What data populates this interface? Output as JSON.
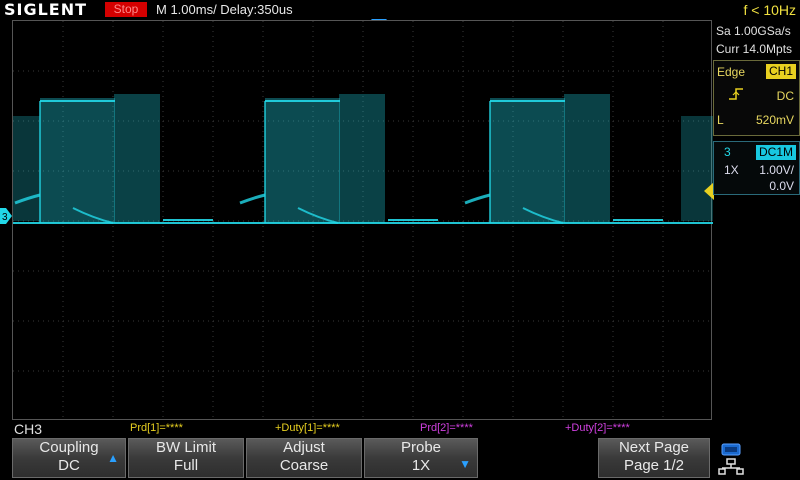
{
  "topbar": {
    "brand": "SIGLENT",
    "run_state": "Stop",
    "timebase": "M 1.00ms/ Delay:350us",
    "frequency": "f < 10Hz"
  },
  "acquisition": {
    "sample_rate": "Sa 1.00GSa/s",
    "memory_depth": "Curr 14.0Mpts"
  },
  "trigger": {
    "type": "Edge",
    "source": "CH1",
    "slope_icon": "rising-edge-icon",
    "coupling": "DC",
    "level_prefix": "L",
    "level": "520mV"
  },
  "channel": {
    "number": "3",
    "coupling": "DC1M",
    "probe": "1X",
    "scale": "1.00V/",
    "offset": "0.0V",
    "marker": "3",
    "label": "CH3"
  },
  "measurements": [
    {
      "text": "Prd[1]=****",
      "color": "#e8d020"
    },
    {
      "text": "+Duty[1]=****",
      "color": "#e8d020"
    },
    {
      "text": "Prd[2]=****",
      "color": "#d040e0"
    },
    {
      "text": "+Duty[2]=****",
      "color": "#d040e0"
    }
  ],
  "softkeys": [
    {
      "line1": "Coupling",
      "line2": "DC",
      "arrow": "▲"
    },
    {
      "line1": "BW Limit",
      "line2": "Full",
      "arrow": ""
    },
    {
      "line1": "Adjust",
      "line2": "Coarse",
      "arrow": ""
    },
    {
      "line1": "Probe",
      "line2": "1X",
      "arrow": "▼"
    },
    {
      "line1": "Next Page",
      "line2": "Page 1/2",
      "arrow": ""
    }
  ],
  "colors": {
    "trace": "#22d8e8",
    "trigger": "#e8d020",
    "run_stop": "#d40000",
    "grid": "#3a3a3a"
  }
}
